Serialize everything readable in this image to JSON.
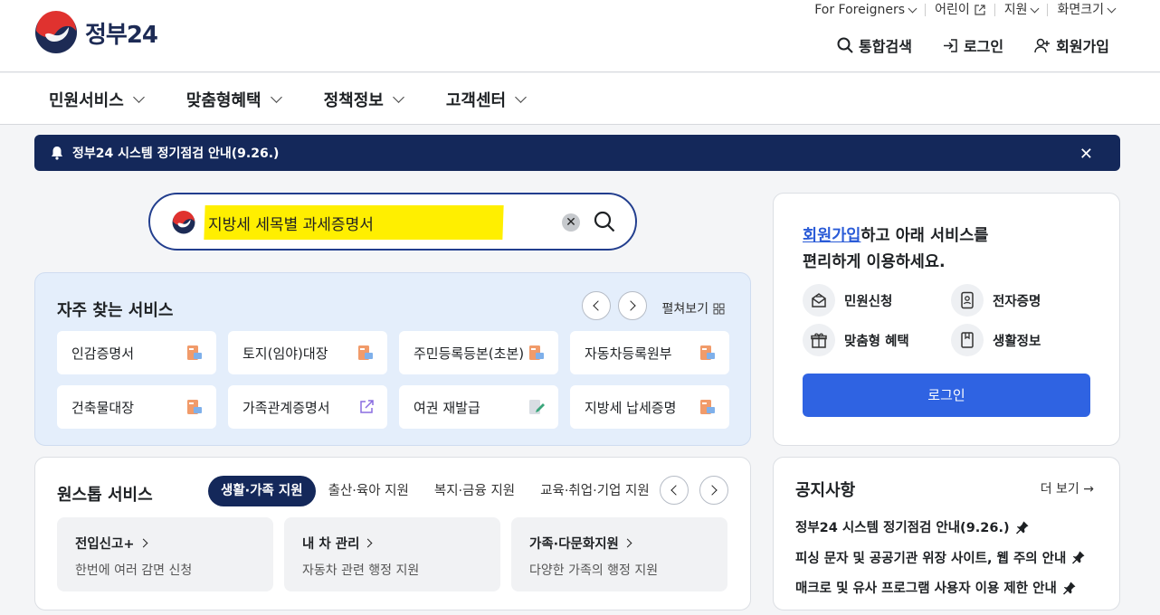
{
  "header": {
    "logo_text": "정부24",
    "utility": [
      "For Foreigners",
      "어린이",
      "지원",
      "화면크기"
    ],
    "actions": {
      "search": "통합검색",
      "login": "로그인",
      "signup": "회원가입"
    }
  },
  "gnb": [
    "민원서비스",
    "맞춤형혜택",
    "정책정보",
    "고객센터"
  ],
  "noticebar": {
    "text": "정부24 시스템 정기점검 안내(9.26.)",
    "close": "✕"
  },
  "search": {
    "query": "지방세 세목별 과세증명서",
    "clear": "✕"
  },
  "frequent": {
    "title": "자주 찾는 서비스",
    "more": "펼쳐보기",
    "items": [
      {
        "label": "인감증명서",
        "icon": "document-icon"
      },
      {
        "label": "토지(임야)대장",
        "icon": "document-icon"
      },
      {
        "label": "주민등록등본(초본)",
        "icon": "document-icon"
      },
      {
        "label": "자동차등록원부",
        "icon": "document-icon"
      },
      {
        "label": "건축물대장",
        "icon": "document-icon"
      },
      {
        "label": "가족관계증명서",
        "icon": "external-link-icon"
      },
      {
        "label": "여권 재발급",
        "icon": "edit-icon"
      },
      {
        "label": "지방세 납세증명",
        "icon": "document-icon"
      }
    ]
  },
  "onestop": {
    "title": "원스톱 서비스",
    "tabs": [
      "생활·가족 지원",
      "출산·육아 지원",
      "복지·금융 지원",
      "교육·취업·기업 지원"
    ],
    "active_tab": 0,
    "cards": [
      {
        "title": "전입신고+",
        "desc": "한번에 여러 감면 신청"
      },
      {
        "title": "내 차 관리",
        "desc": "자동차 관련 행정 지원"
      },
      {
        "title": "가족·다문화지원",
        "desc": "다양한 가족의 행정 지원"
      }
    ]
  },
  "loginbox": {
    "link": "회원가입",
    "msg1": "하고 아래 서비스를",
    "msg2": "편리하게 이용하세요.",
    "items": [
      "민원신청",
      "전자증명",
      "맞춤형 혜택",
      "생활정보"
    ],
    "button": "로그인"
  },
  "notices": {
    "title": "공지사항",
    "more": "더 보기 →",
    "items": [
      "정부24 시스템 정기점검 안내(9.26.)",
      "피싱 문자 및 공공기관 위장 사이트, 웹 주의 안내",
      "매크로 및 유사 프로그램 사용자 이용 제한 안내"
    ]
  },
  "colors": {
    "navy": "#14285a",
    "blue": "#2f63e2",
    "highlight": "#ffef00",
    "link": "#2a5bd7"
  }
}
